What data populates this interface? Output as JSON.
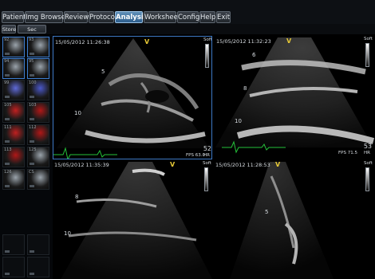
{
  "tabs": [
    {
      "label": "Patient",
      "active": false
    },
    {
      "label": "Img Browser",
      "active": false
    },
    {
      "label": "Review",
      "active": false
    },
    {
      "label": "Protocol",
      "active": false
    },
    {
      "label": "Analysis",
      "active": true
    },
    {
      "label": "Worksheet",
      "active": false
    },
    {
      "label": "Config",
      "active": false
    },
    {
      "label": "Help",
      "active": false
    },
    {
      "label": "Exit",
      "active": false
    }
  ],
  "toolbar": {
    "store_label": "Store",
    "sec_capture_label": "Sec capture"
  },
  "thumbnails": [
    {
      "num": "92",
      "color": "#9aa3ab"
    },
    {
      "num": "93",
      "color": "#9aa3ab"
    },
    {
      "num": "94",
      "color": "#9aa3ab"
    },
    {
      "num": "95",
      "color": "#9aa3ab"
    },
    {
      "num": "99",
      "color": "#5f6ad8"
    },
    {
      "num": "100",
      "color": "#4a57c8"
    },
    {
      "num": "105",
      "color": "#c02020"
    },
    {
      "num": "103",
      "color": "#b01818"
    },
    {
      "num": "111",
      "color": "#c02020"
    },
    {
      "num": "112",
      "color": "#b01818"
    },
    {
      "num": "113",
      "color": "#b01818"
    },
    {
      "num": "125",
      "color": "#9aa3ab"
    },
    {
      "num": "126",
      "color": "#9aa3ab"
    },
    {
      "num": "CS",
      "color": "#9aa3ab"
    }
  ],
  "panes": [
    {
      "timestamp": "15/05/2012 11:26:38",
      "probe_mark": "V",
      "soft_label": "Soft",
      "depth_marks": [
        "5",
        "10"
      ],
      "frame_number": "52",
      "hr_label": "HR",
      "fps": "FPS 63.0"
    },
    {
      "timestamp": "15/05/2012 11:32:23",
      "probe_mark": "V",
      "soft_label": "Soft",
      "depth_marks": [
        "6",
        "8",
        "10"
      ],
      "frame_number": "53",
      "hr_label": "HR",
      "fps": "FPS 71.5"
    },
    {
      "timestamp": "15/05/2012 11:35:39",
      "probe_mark": "V",
      "soft_label": "Soft",
      "depth_marks": [
        "8",
        "10"
      ]
    },
    {
      "timestamp": "15/05/2012 11:28:53",
      "probe_mark": "V",
      "soft_label": "Soft",
      "depth_marks": [
        "5"
      ]
    }
  ],
  "colors": {
    "accent": "#3d78c4",
    "probe_mark": "#e7c936",
    "ecg": "#25c23a"
  },
  "icons": {
    "thumbnail_tag": "thumbnail-tag-icon"
  }
}
